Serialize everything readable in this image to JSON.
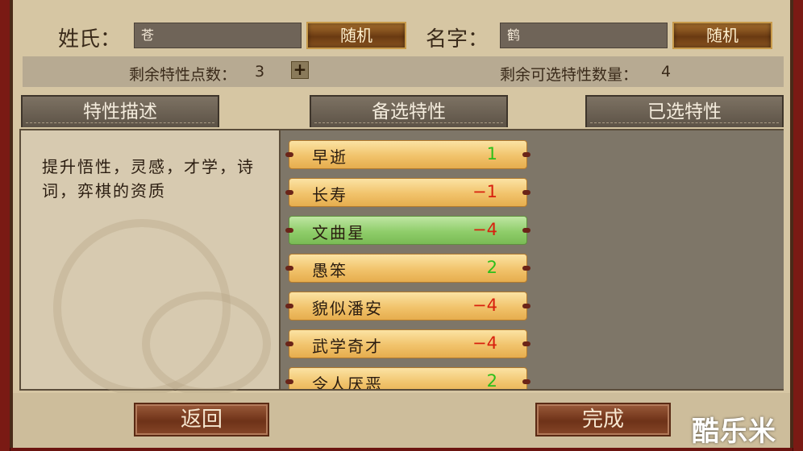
{
  "header": {
    "surname_label": "姓氏：",
    "surname_value": "苍",
    "given_label": "名字：",
    "given_value": "鹤",
    "random_label": "随机"
  },
  "info": {
    "points_label": "剩余特性点数：",
    "points_value": "3",
    "plus_symbol": "+",
    "selectable_label": "剩余可选特性数量：",
    "selectable_value": "4"
  },
  "tabs": {
    "description": "特性描述",
    "available": "备选特性",
    "selected": "已选特性"
  },
  "description_text": "提升悟性，灵感，才学，诗词，弈棋的资质",
  "traits": [
    {
      "name": "早逝",
      "value": "1",
      "state": "normal"
    },
    {
      "name": "长寿",
      "value": "−1",
      "state": "normal"
    },
    {
      "name": "文曲星",
      "value": "−4",
      "state": "selected"
    },
    {
      "name": "愚笨",
      "value": "2",
      "state": "normal"
    },
    {
      "name": "貌似潘安",
      "value": "−4",
      "state": "normal"
    },
    {
      "name": "武学奇才",
      "value": "−4",
      "state": "normal"
    },
    {
      "name": "令人厌恶",
      "value": "2",
      "state": "normal"
    }
  ],
  "buttons": {
    "back": "返回",
    "done": "完成"
  },
  "watermark": "酷乐米",
  "colors": {
    "positive": "#2dbf1a",
    "negative": "#d8200e",
    "selected_row": "#8fcd6a",
    "normal_row": "#f1c36b"
  }
}
